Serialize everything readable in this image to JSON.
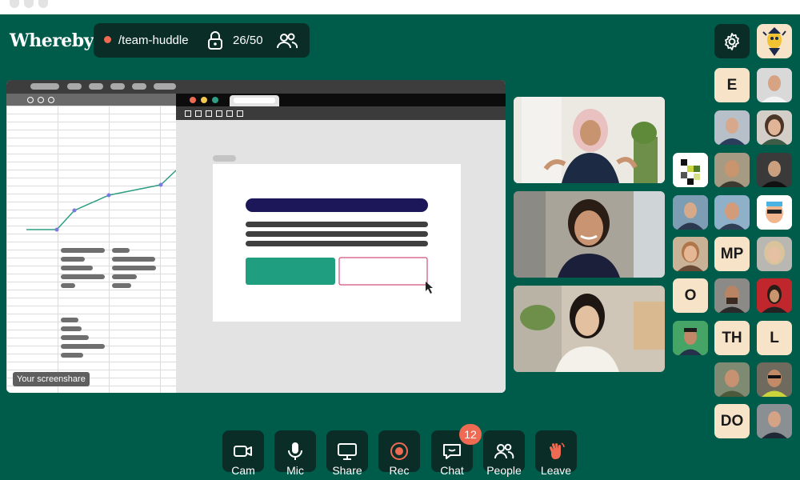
{
  "app": {
    "logo": "Whereby"
  },
  "room": {
    "name": "/team-huddle",
    "participant_count": "26/50",
    "lock_icon": "lock-icon",
    "people_icon": "people-icon"
  },
  "colors": {
    "background": "#005c4a",
    "surface_dark": "#0a2e27",
    "accent_red": "#ee6a53",
    "initials_tile": "#f6e3c8"
  },
  "screenshare": {
    "label": "Your screenshare"
  },
  "participants": {
    "initials": [
      "E",
      "MP",
      "O",
      "TH",
      "L",
      "DO"
    ]
  },
  "toolbar": {
    "items": [
      {
        "label": "Cam",
        "icon": "camera-icon"
      },
      {
        "label": "Mic",
        "icon": "microphone-icon"
      },
      {
        "label": "Share",
        "icon": "monitor-icon"
      },
      {
        "label": "Rec",
        "icon": "record-icon"
      },
      {
        "label": "Chat",
        "icon": "chat-icon",
        "badge": "12"
      },
      {
        "label": "People",
        "icon": "people-icon"
      },
      {
        "label": "Leave",
        "icon": "wave-hand-icon"
      }
    ]
  }
}
